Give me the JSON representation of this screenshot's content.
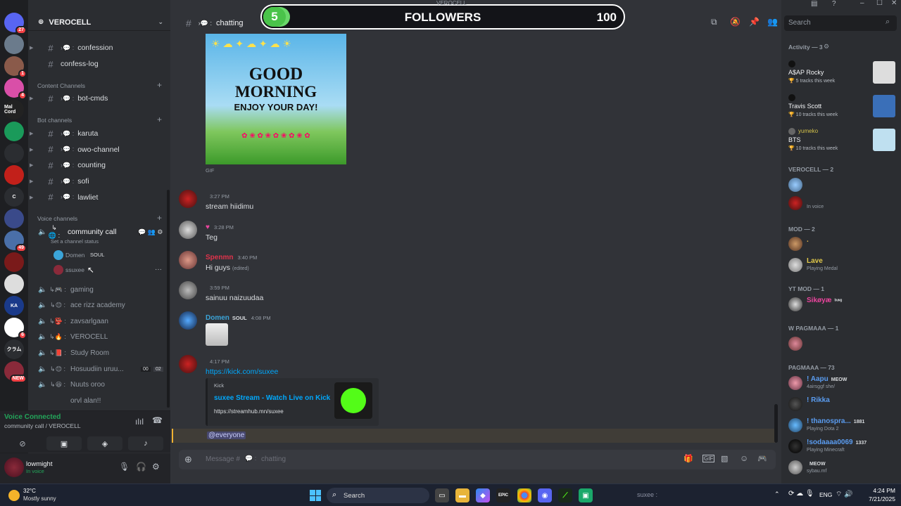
{
  "window": {
    "title": "VEROCELL"
  },
  "overlay": {
    "current": "5",
    "label": "FOLLOWERS",
    "goal": "100",
    "progress_fraction": 0.05
  },
  "servers": [
    {
      "name": "discord-home",
      "badge": "27",
      "color": "#5865f2",
      "label": ""
    },
    {
      "name": "server-2",
      "badge": "",
      "color": "#6b7b8c",
      "label": ""
    },
    {
      "name": "server-3",
      "badge": "1",
      "color": "#8a5a4a",
      "label": ""
    },
    {
      "name": "server-4",
      "badge": "4",
      "color": "#d94fa8",
      "label": ""
    },
    {
      "name": "server-5",
      "badge": "",
      "color": "#222",
      "label": "Mal Cord"
    },
    {
      "name": "server-6",
      "badge": "",
      "color": "#1a9a5a",
      "label": ""
    },
    {
      "name": "server-7",
      "badge": "",
      "color": "#2b2d31",
      "label": ""
    },
    {
      "name": "server-8",
      "badge": "",
      "color": "#c2201a",
      "label": ""
    },
    {
      "name": "server-9",
      "badge": "",
      "color": "#2b2d31",
      "label": "C"
    },
    {
      "name": "server-10",
      "badge": "",
      "color": "#3a4a8a",
      "label": ""
    },
    {
      "name": "server-11",
      "badge": "49",
      "color": "#4a6fa8",
      "label": ""
    },
    {
      "name": "server-12",
      "badge": "",
      "color": "#7a1a1a",
      "label": ""
    },
    {
      "name": "server-13",
      "badge": "",
      "color": "#ddd",
      "label": ""
    },
    {
      "name": "server-14",
      "badge": "",
      "color": "#1a3a8a",
      "label": "KA"
    },
    {
      "name": "server-15",
      "badge": "6",
      "color": "#fff",
      "label": ""
    },
    {
      "name": "server-16",
      "badge": "",
      "color": "#2b2d31",
      "label": "クラム"
    },
    {
      "name": "server-17",
      "badge": "NEW",
      "color": "#8a2a3a",
      "label": ""
    }
  ],
  "sidebar": {
    "server_name": "VEROCELL",
    "top_channels": [
      {
        "label": "confession",
        "arrow": true
      },
      {
        "label": "confess-log",
        "arrow": false
      }
    ],
    "content_category": "Content Channels",
    "content_channels": [
      {
        "label": "bot-cmds"
      }
    ],
    "bot_category": "Bot channels",
    "bot_channels": [
      {
        "label": "karuta"
      },
      {
        "label": "owo-channel"
      },
      {
        "label": "counting"
      },
      {
        "label": "sofi"
      },
      {
        "label": "lawliet"
      }
    ],
    "voice_category": "Voice channels",
    "community_call": {
      "label": "community call",
      "status": "Set a channel status"
    },
    "voice_users": [
      {
        "name": "Domen",
        "tag": "SOUL"
      },
      {
        "name": "ssuxee"
      }
    ],
    "voice_channels": [
      {
        "label": "gaming"
      },
      {
        "label": "ace rizz academy"
      },
      {
        "label": "zavsarlgaan"
      },
      {
        "label": "VEROCELL"
      },
      {
        "label": "Study Room"
      },
      {
        "label": "Hosuudiin uruu..."
      },
      {
        "label": "Nuuts oroo"
      },
      {
        "label": "orvl alan!!"
      }
    ],
    "hosuu_counts": [
      "00",
      "02"
    ]
  },
  "voice": {
    "status": "Voice Connected",
    "channel": "community call / VEROCELL"
  },
  "user": {
    "name": "lowmight",
    "status": "In voice"
  },
  "chat": {
    "channel": "chatting",
    "gif": {
      "line1": "GOOD",
      "line2": "MORNING",
      "line3": "ENJOY YOUR DAY!",
      "label": "GIF"
    },
    "messages": [
      {
        "author": "",
        "time": "3:27 PM",
        "text": "stream hiidimu",
        "color": "#e0334b"
      },
      {
        "author": "",
        "time": "3:28 PM",
        "text": "Teg",
        "color": "#eb459e"
      },
      {
        "author": "Spenmn",
        "time": "3:40 PM",
        "text": "Hi guys",
        "edited": "(edited)",
        "color": "#e0334b"
      },
      {
        "author": "",
        "time": "3:59 PM",
        "text": "sainuu naizuudaa",
        "color": "#9b59b6"
      },
      {
        "author": "Domen",
        "tag": "SOUL",
        "time": "4:08 PM",
        "text": "",
        "color": "#3ba4d8"
      },
      {
        "author": "",
        "time": "4:17 PM",
        "text": "https://kick.com/suxee",
        "color": "#e0334b"
      }
    ],
    "embed": {
      "provider": "Kick",
      "title": "suxee Stream - Watch Live on Kick",
      "url": "https://streamhub.mn/suxee"
    },
    "mention": "@everyone",
    "input_placeholder": "Message #",
    "input_channel": "chatting"
  },
  "search": {
    "placeholder": "Search"
  },
  "members": {
    "activity_header": "Activity — 3",
    "activity": [
      {
        "user": "",
        "artist": "A$AP Rocky",
        "tracks": "5 tracks this week",
        "color": "#e0334b"
      },
      {
        "user": "",
        "artist": "Travis Scott",
        "tracks": "10 tracks this week",
        "color": "#e0334b"
      },
      {
        "user": "yumeko",
        "artist": "BTS",
        "tracks": "10 tracks this week",
        "color": "#d4c24a"
      }
    ],
    "verocell_header": "VEROCELL — 2",
    "verocell": [
      {
        "name": "",
        "sub": "",
        "color": "#e0334b"
      },
      {
        "name": "",
        "sub": "In voice",
        "color": "#e0334b"
      }
    ],
    "mod_header": "MOD — 2",
    "mod": [
      {
        "name": ".",
        "sub": "",
        "color": "#e0b84a"
      },
      {
        "name": "Lave",
        "sub": "Playing Medal",
        "color": "#e0c84a"
      }
    ],
    "ytmod_header": "YT MOD — 1",
    "ytmod": [
      {
        "name": "Sikøyæ",
        "sub": "",
        "tag": "ᵇᵘᶰᵍ",
        "color": "#eb459e"
      }
    ],
    "wpag_header": "W PAGMAAA — 1",
    "wpag": [
      {
        "name": "",
        "sub": "",
        "color": "#9b59b6"
      }
    ],
    "pag_header": "PAGMAAA — 73",
    "pag": [
      {
        "name": "! Aapu",
        "tag": "MEOW",
        "sub": "4airsggf she/",
        "color": "#5a9cf0"
      },
      {
        "name": "! Rikka",
        "sub": "",
        "color": "#5a9cf0"
      },
      {
        "name": "! thanospra...",
        "tag": "1881",
        "sub": "Playing Dota 2",
        "color": "#5a9cf0"
      },
      {
        "name": "!sodaaaa0069",
        "tag": "1337",
        "sub": "Playing Minecraft",
        "color": "#5a9cf0"
      },
      {
        "name": "",
        "tag": "MEOW",
        "sub": "sybau.mf",
        "color": "#5a9cf0"
      }
    ]
  },
  "taskbar": {
    "temp": "32°C",
    "weather": "Mostly sunny",
    "search": "Search",
    "lang": "ENG",
    "time": "4:24 PM",
    "date": "7/21/2025",
    "mini_label": "suxee :"
  }
}
